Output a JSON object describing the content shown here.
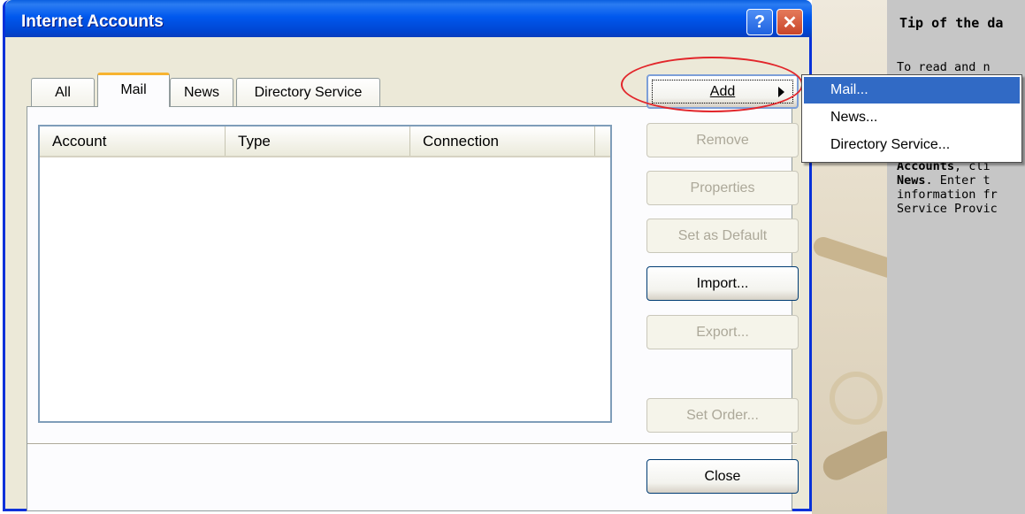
{
  "window": {
    "title": "Internet Accounts",
    "help_glyph": "?",
    "close_glyph": "✕"
  },
  "tabs": [
    {
      "label": "All",
      "active": false
    },
    {
      "label": "Mail",
      "active": true
    },
    {
      "label": "News",
      "active": false
    },
    {
      "label": "Directory Service",
      "active": false
    }
  ],
  "list": {
    "columns": [
      "Account",
      "Type",
      "Connection"
    ],
    "rows": []
  },
  "buttons": {
    "add": "Add",
    "remove": "Remove",
    "properties": "Properties",
    "set_default": "Set as Default",
    "import": "Import...",
    "export": "Export...",
    "set_order": "Set Order...",
    "close": "Close"
  },
  "add_menu": {
    "items": [
      {
        "label": "Mail...",
        "selected": true
      },
      {
        "label": "News...",
        "selected": false
      },
      {
        "label": "Directory Service...",
        "selected": false
      }
    ]
  },
  "tip": {
    "title": "Tip of the da",
    "line1": "To read and n",
    "line_bold1": "Accounts",
    "line_bold1_rest": ", cli",
    "line_bold2": "News",
    "line_bold2_rest": ". Enter t",
    "line3": "information fr",
    "line4": "Service Provic"
  },
  "colors": {
    "title_bar": "#0058ee",
    "dialog_bg": "#ece9d8",
    "selected_menu": "#316ac5",
    "annotation": "#e2262b",
    "active_tab_accent": "#f7b330"
  },
  "icons": {
    "help": "help-icon",
    "close": "close-icon",
    "submenu": "chevron-right-icon"
  }
}
